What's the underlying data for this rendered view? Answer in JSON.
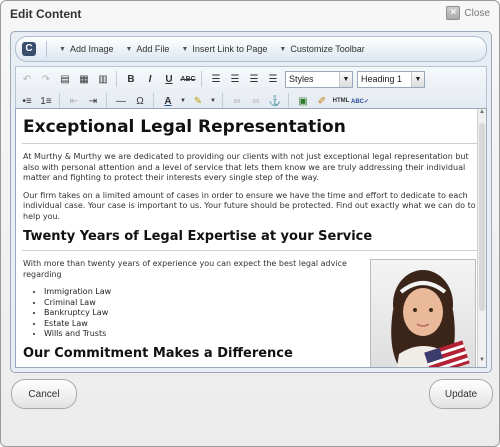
{
  "dialog": {
    "title": "Edit Content",
    "close_label": "Close"
  },
  "content_toolbar": {
    "items": [
      {
        "label": "Add Image"
      },
      {
        "label": "Add File"
      },
      {
        "label": "Insert Link to Page"
      },
      {
        "label": "Customize Toolbar"
      }
    ]
  },
  "rich_toolbar": {
    "style_select": "Styles",
    "format_select": "Heading 1"
  },
  "document": {
    "heading1": "Exceptional Legal Representation",
    "para1": "At Murthy & Murthy we are dedicated to providing our clients with not just exceptional legal representation but also with personal attention and a level of service that lets them know we are truly addressing their individual matter and fighting to protect their interests every single step of the way.",
    "para2": "Our firm takes on a limited amount of cases in order to ensure we have the time and effort to dedicate to each individual case. Your case is important to us. Your future should be protected. Find out exactly what we can do to help you.",
    "heading2": "Twenty Years of Legal Expertise at your Service",
    "para3": "With more than twenty years of experience you can expect the best legal advice regarding",
    "list": [
      "Immigration Law",
      "Criminal Law",
      "Bankruptcy Law",
      "Estate Law",
      "Wills and Trusts"
    ],
    "heading3": "Our Commitment Makes a Difference"
  },
  "buttons": {
    "cancel": "Cancel",
    "update": "Update"
  }
}
